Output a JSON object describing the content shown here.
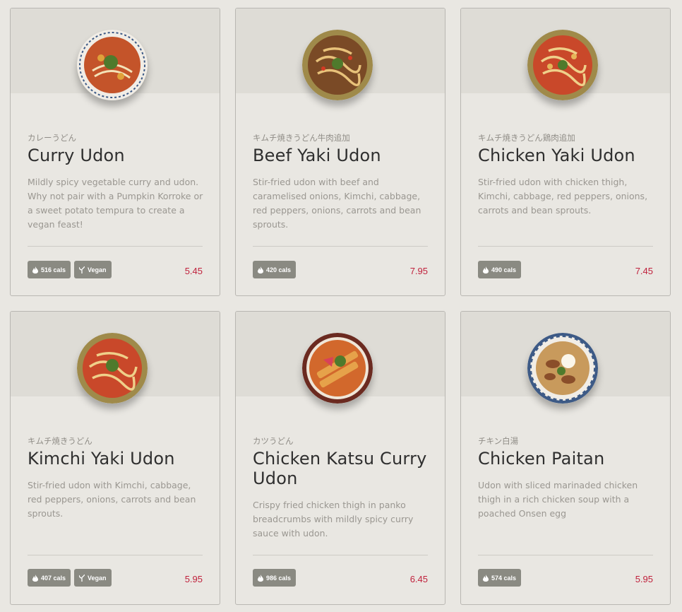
{
  "menu": {
    "items": [
      {
        "jp_name": "カレーうどん",
        "name": "Curry Udon",
        "description": "Mildly spicy vegetable curry and udon. Why not pair with a Pumpkin Korroke or a sweet potato tempura to create a vegan feast!",
        "cals": "516 cals",
        "vegan": "Vegan",
        "price": "5.45",
        "bowl_rim": "#f1ede6",
        "bowl_food": "#c4542a",
        "bowl_topping": "#4f7a2c"
      },
      {
        "jp_name": "キムチ焼きうどん牛肉追加",
        "name": "Beef Yaki Udon",
        "description": "Stir-fried udon with beef and caramelised onions, Kimchi, cabbage, red peppers, onions, carrots and bean sprouts.",
        "cals": "420 cals",
        "vegan": "",
        "price": "7.95",
        "bowl_rim": "#9f8a4a",
        "bowl_food": "#7a4a26",
        "bowl_topping": "#4f7a2c"
      },
      {
        "jp_name": "キムチ焼きうどん鶏肉追加",
        "name": "Chicken Yaki Udon",
        "description": "Stir-fried udon with chicken thigh, Kimchi, cabbage, red peppers, onions, carrots and bean sprouts.",
        "cals": "490 cals",
        "vegan": "",
        "price": "7.45",
        "bowl_rim": "#9f8a4a",
        "bowl_food": "#c9482a",
        "bowl_topping": "#4f7a2c"
      },
      {
        "jp_name": "キムチ焼きうどん",
        "name": "Kimchi Yaki Udon",
        "description": "Stir-fried udon with Kimchi, cabbage, red peppers, onions, carrots and bean sprouts.",
        "cals": "407 cals",
        "vegan": "Vegan",
        "price": "5.95",
        "bowl_rim": "#9f8a4a",
        "bowl_food": "#c9482a",
        "bowl_topping": "#4f7a2c"
      },
      {
        "jp_name": "カツうどん",
        "name": "Chicken Katsu Curry Udon",
        "description": "Crispy fried chicken thigh in panko breadcrumbs with mildly spicy curry sauce with udon.",
        "cals": "986 cals",
        "vegan": "",
        "price": "6.45",
        "bowl_rim": "#6b2a20",
        "bowl_food": "#d2682c",
        "bowl_topping": "#4f7a2c"
      },
      {
        "jp_name": "チキン白湯",
        "name": "Chicken Paitan",
        "description": "Udon with sliced marinaded chicken thigh in a rich chicken soup with a poached Onsen egg",
        "cals": "574 cals",
        "vegan": "",
        "price": "5.95",
        "bowl_rim": "#3d5a86",
        "bowl_food": "#c89a5c",
        "bowl_topping": "#4f7a2c"
      }
    ]
  },
  "colors": {
    "price": "#c0213c",
    "badge_bg": "#8a8a82",
    "card_bg": "#e9e7e2",
    "card_top": "#dedcd6"
  }
}
